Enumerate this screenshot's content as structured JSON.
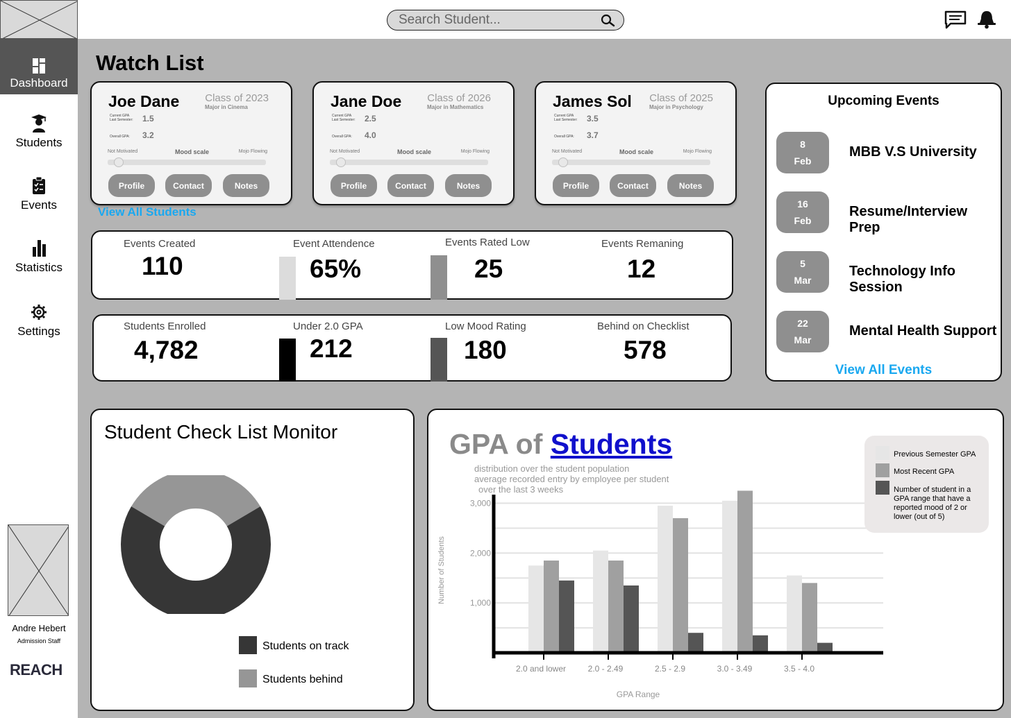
{
  "header": {
    "search_placeholder": "Search Student...",
    "icons": [
      "search-icon",
      "message-icon",
      "bell-icon"
    ]
  },
  "sidebar": {
    "items": [
      {
        "label": "Dashboard",
        "icon": "dashboard-icon",
        "active": true
      },
      {
        "label": "Students",
        "icon": "graduate-icon",
        "active": false
      },
      {
        "label": "Events",
        "icon": "clipboard-icon",
        "active": false
      },
      {
        "label": "Statistics",
        "icon": "bar-chart-icon",
        "active": false
      },
      {
        "label": "Settings",
        "icon": "gear-icon",
        "active": false
      }
    ],
    "user": {
      "name": "Andre Hebert",
      "role": "Admission Staff"
    },
    "brand": "REACH"
  },
  "watch_list": {
    "title": "Watch List",
    "view_all": "View All Students",
    "labels": {
      "current_gpa": "Current GPA",
      "last_semester": "Last Semester:",
      "overall_gpa": "Overall GPA:",
      "not_motivated": "Not Motivated",
      "mood_scale": "Mood scale",
      "mojo_flowing": "Mojo Flowing"
    },
    "buttons": {
      "profile": "Profile",
      "contact": "Contact",
      "notes": "Notes"
    },
    "students": [
      {
        "name": "Joe Dane",
        "class": "Class of 2023",
        "major": "Major in Cinema",
        "last_gpa": "1.5",
        "overall_gpa": "3.2",
        "mood": 0.07
      },
      {
        "name": "Jane Doe",
        "class": "Class of 2026",
        "major": "Major in Mathematics",
        "last_gpa": "2.5",
        "overall_gpa": "4.0",
        "mood": 0.07
      },
      {
        "name": "James Sol",
        "class": "Class of 2025",
        "major": "Major in Psychology",
        "last_gpa": "3.5",
        "overall_gpa": "3.7",
        "mood": 0.07
      }
    ]
  },
  "event_stats": [
    {
      "label": "Events Created",
      "value": "110"
    },
    {
      "label": "Event Attendence",
      "value": "65%"
    },
    {
      "label": "Events Rated Low",
      "value": "25"
    },
    {
      "label": "Events Remaning",
      "value": "12"
    }
  ],
  "student_stats": [
    {
      "label": "Students Enrolled",
      "value": "4,782"
    },
    {
      "label": "Under 2.0 GPA",
      "value": "212"
    },
    {
      "label": "Low Mood Rating",
      "value": "180"
    },
    {
      "label": "Behind on Checklist",
      "value": "578"
    }
  ],
  "upcoming_events": {
    "title": "Upcoming Events",
    "view_all": "View All Events",
    "items": [
      {
        "day": "8",
        "month": "Feb",
        "name": "MBB V.S University"
      },
      {
        "day": "16",
        "month": "Feb",
        "name": "Resume/Interview Prep"
      },
      {
        "day": "5",
        "month": "Mar",
        "name": "Technology Info Session"
      },
      {
        "day": "22",
        "month": "Mar",
        "name": "Mental Health Support"
      }
    ]
  },
  "checklist_monitor": {
    "title": "Student Check List Monitor",
    "legend": [
      {
        "label": "Students on track",
        "color": "#363636"
      },
      {
        "label": "Students behind",
        "color": "#969696"
      }
    ]
  },
  "gpa_chart": {
    "title_prefix": "GPA of",
    "title_link": "Students",
    "subtitle": [
      "distribution over the student population",
      "average recorded entry by employee per student",
      "over the last 3 weeks"
    ]
  },
  "chart_data": [
    {
      "type": "pie",
      "title": "Student Check List Monitor",
      "labels": [
        "Students on track",
        "Students behind"
      ],
      "values": [
        67,
        33
      ],
      "colors": [
        "#363636",
        "#969696"
      ]
    },
    {
      "type": "bar",
      "title": "GPA of Students",
      "xlabel": "GPA Range",
      "ylabel": "Number of Students",
      "categories": [
        "2.0 and lower",
        "2.0 - 2.49",
        "2.5 - 2.9",
        "3.0 - 3.49",
        "3.5 - 4.0"
      ],
      "yticks": [
        "1,000",
        "2,000",
        "3,000"
      ],
      "ylim": [
        0,
        3200
      ],
      "series": [
        {
          "name": "Previous Semester GPA",
          "color": "#e6e6e6",
          "values": [
            1750,
            2050,
            2950,
            3050,
            1550
          ]
        },
        {
          "name": "Most Recent GPA",
          "color": "#a0a0a0",
          "values": [
            1850,
            1850,
            2700,
            3250,
            1400
          ]
        },
        {
          "name": "Number of student in a GPA range that have a reported mood of 2 or lower (out of 5)",
          "color": "#555555",
          "values": [
            1450,
            1350,
            400,
            350,
            200
          ]
        }
      ],
      "grid": true,
      "legend": "top-right"
    }
  ]
}
